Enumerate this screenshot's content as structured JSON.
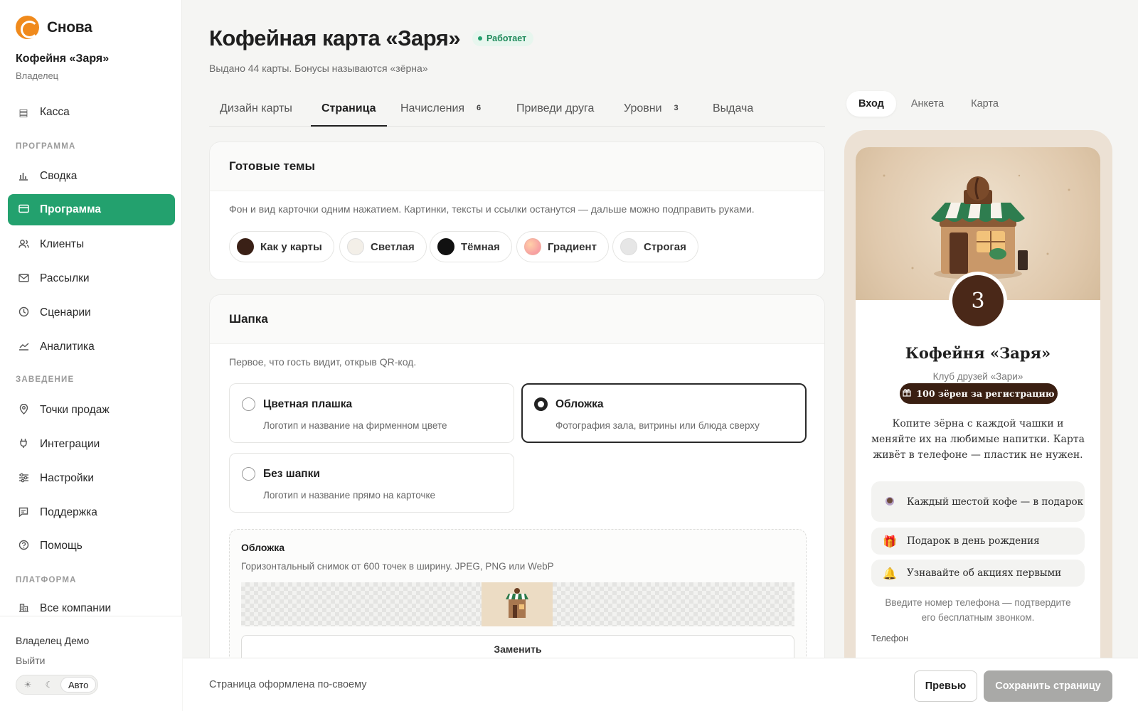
{
  "sidebar": {
    "brand": "Снова",
    "org_name": "Кофейня «Заря»",
    "org_role": "Владелец",
    "kassa": "Касса",
    "section_program": "ПРОГРАММА",
    "svodka": "Сводка",
    "programma": "Программа",
    "clients": "Клиенты",
    "mailings": "Рассылки",
    "scenarios": "Сценарии",
    "analytics": "Аналитика",
    "section_venue": "ЗАВЕДЕНИЕ",
    "points": "Точки продаж",
    "integrations": "Интеграции",
    "settings": "Настройки",
    "support": "Поддержка",
    "help": "Помощь",
    "section_platform": "ПЛАТФОРМА",
    "all_companies": "Все компании",
    "owner": "Владелец Демо",
    "logout": "Выйти",
    "theme_auto": "Авто"
  },
  "header": {
    "title": "Кофейная карта «Заря»",
    "status": "Работает",
    "subtitle": "Выдано 44 карты. Бонусы называются «зёрна»"
  },
  "tabs": {
    "design": "Дизайн карты",
    "page": "Страница",
    "accruals": "Начисления",
    "accruals_count": "6",
    "referral": "Приведи друга",
    "levels": "Уровни",
    "levels_count": "3",
    "issue": "Выдача"
  },
  "themes_card": {
    "title": "Готовые темы",
    "description": "Фон и вид карточки одним нажатием. Картинки, тексты и ссылки останутся — дальше можно подправить руками.",
    "chips": [
      {
        "label": "Как у карты",
        "color": "#3a2016"
      },
      {
        "label": "Светлая",
        "color": "#f3efe8"
      },
      {
        "label": "Тёмная",
        "color": "#111111"
      },
      {
        "label": "Градиент",
        "color": "#f4a28c"
      },
      {
        "label": "Строгая",
        "color": "#e6e6e6"
      }
    ]
  },
  "header_card": {
    "title": "Шапка",
    "description": "Первое, что гость видит, открыв QR-код.",
    "opt_color_title": "Цветная плашка",
    "opt_color_desc": "Логотип и название на фирменном цвете",
    "opt_cover_title": "Обложка",
    "opt_cover_desc": "Фотография зала, витрины или блюда сверху",
    "opt_none_title": "Без шапки",
    "opt_none_desc": "Логотип и название прямо на карточке",
    "upload_title": "Обложка",
    "upload_desc": "Горизонтальный снимок от 600 точек в ширину. JPEG, PNG или WebP",
    "replace": "Заменить"
  },
  "bottom_bar": {
    "status": "Страница оформлена по-своему",
    "preview": "Превью",
    "save": "Сохранить страницу"
  },
  "preview": {
    "tab_login": "Вход",
    "tab_form": "Анкета",
    "tab_card": "Карта",
    "level": "3",
    "shop_name": "Кофейня «Заря»",
    "club": "Клуб друзей «Зари»",
    "reg_bonus": "100 зёрен за регистрацию",
    "description": "Копите зёрна с каждой чашки и меняйте их на любимые напитки. Карта живёт в телефоне — пластик не нужен.",
    "perk1": "Каждый шестой кофе — в подарок",
    "perk2": "Подарок в день рождения",
    "perk3": "Узнавайте об акциях первыми",
    "hint": "Введите номер телефона — подтвердите его бесплатным звонком.",
    "phone_label": "Телефон"
  },
  "colors": {
    "accent": "#23a16e",
    "brand": "#f08a1c",
    "coffee": "#4a2818"
  }
}
